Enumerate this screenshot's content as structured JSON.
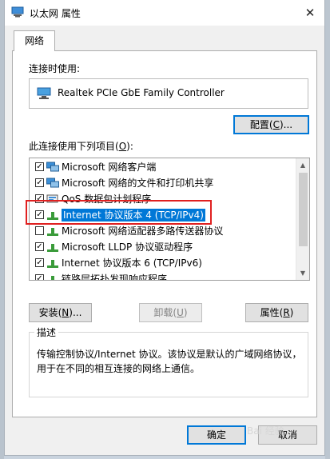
{
  "window": {
    "title": "以太网 属性",
    "close_glyph": "✕"
  },
  "tabs": [
    {
      "label": "网络"
    }
  ],
  "connect_using": {
    "label": "连接时使用:",
    "adapter_name": "Realtek PCIe GbE Family Controller",
    "configure_button": {
      "prefix": "配置(",
      "key": "C",
      "suffix": ")..."
    }
  },
  "items_section": {
    "label": {
      "prefix": "此连接使用下列项目(",
      "key": "O",
      "suffix": "):"
    },
    "items": [
      {
        "label": "Microsoft 网络客户端",
        "checked": true,
        "icon": "network-client-icon"
      },
      {
        "label": "Microsoft 网络的文件和打印机共享",
        "checked": true,
        "icon": "network-client-icon"
      },
      {
        "label": "QoS 数据包计划程序",
        "checked": true,
        "icon": "service-icon"
      },
      {
        "label": "Internet 协议版本 4 (TCP/IPv4)",
        "checked": true,
        "icon": "protocol-icon",
        "selected": true
      },
      {
        "label": "Microsoft 网络适配器多路传送器协议",
        "checked": false,
        "icon": "protocol-icon"
      },
      {
        "label": "Microsoft LLDP 协议驱动程序",
        "checked": true,
        "icon": "protocol-icon"
      },
      {
        "label": "Internet 协议版本 6 (TCP/IPv6)",
        "checked": true,
        "icon": "protocol-icon"
      },
      {
        "label": "链路层拓扑发现响应程序",
        "checked": true,
        "icon": "protocol-icon"
      }
    ],
    "buttons": {
      "install": {
        "prefix": "安装(",
        "key": "N",
        "suffix": ")..."
      },
      "uninstall": {
        "prefix": "卸载(",
        "key": "U",
        "suffix": ")"
      },
      "properties": {
        "prefix": "属性(",
        "key": "R",
        "suffix": ")"
      }
    }
  },
  "description": {
    "title": "描述",
    "text": "传输控制协议/Internet 协议。该协议是默认的广域网络协议，用于在不同的相互连接的网络上通信。"
  },
  "footer": {
    "ok_label": "确定",
    "cancel_label": "取消"
  },
  "watermark": "Bai 经验",
  "colors": {
    "selection": "#0078d7",
    "highlight_box": "#e02020",
    "focus_border": "#0078d7"
  }
}
